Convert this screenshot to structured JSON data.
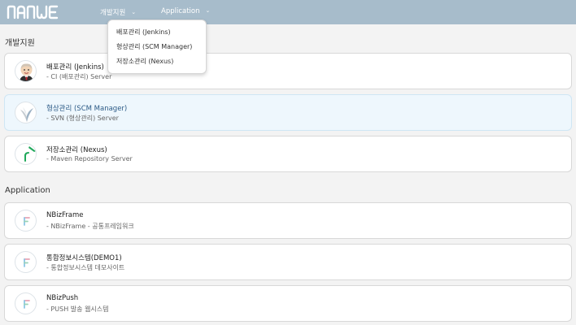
{
  "header": {
    "logo_text": "NANWE",
    "nav": [
      {
        "label": "개발지원",
        "caret": "⌄"
      },
      {
        "label": "Application",
        "caret": "⌄"
      }
    ]
  },
  "dropdown": {
    "items": [
      {
        "label": "배포관리 (Jenkins)"
      },
      {
        "label": "형상관리 (SCM Manager)"
      },
      {
        "label": "저장소관리 (Nexus)"
      }
    ]
  },
  "sections": [
    {
      "title": "개발지원",
      "cards": [
        {
          "title": "배포관리 (Jenkins)",
          "desc": "- CI (배포관리) Server",
          "icon": "jenkins-icon",
          "selected": false
        },
        {
          "title": "형상관리 (SCM Manager)",
          "desc": "- SVN (형상관리) Server",
          "icon": "scm-manager-icon",
          "selected": true
        },
        {
          "title": "저장소관리 (Nexus)",
          "desc": "- Maven Repository Server",
          "icon": "nexus-icon",
          "selected": false
        }
      ]
    },
    {
      "title": "Application",
      "cards": [
        {
          "title": "NBizFrame",
          "desc": "- NBizFrame - 공통프레임워크",
          "icon": "nbiz-icon",
          "selected": false
        },
        {
          "title": "통합정보시스템(DEMO1)",
          "desc": "- 통합정보시스템 데모사이트",
          "icon": "nbiz-icon",
          "selected": false
        },
        {
          "title": "NBizPush",
          "desc": "- PUSH 발송 웹시스템",
          "icon": "nbiz-icon",
          "selected": false
        }
      ]
    }
  ],
  "colors": {
    "header_bg": "#a7bccb",
    "page_bg": "#f3f3f3",
    "selected_card_bg": "#eef7fd",
    "selected_title": "#2c5a86",
    "nexus_green": "#1fa85a"
  }
}
